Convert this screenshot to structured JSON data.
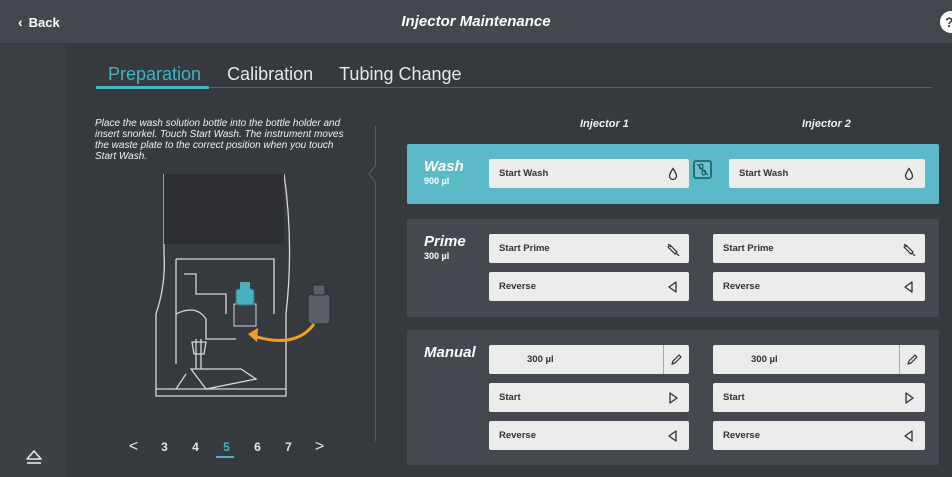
{
  "header": {
    "back_label": "Back",
    "title": "Injector Maintenance",
    "help_label": "?"
  },
  "tabs": [
    {
      "label": "Preparation",
      "active": true
    },
    {
      "label": "Calibration",
      "active": false
    },
    {
      "label": "Tubing Change",
      "active": false
    }
  ],
  "instructions": "Place the wash solution bottle into the bottle holder and insert snorkel. Touch Start Wash. The instrument moves the waste plate to the correct position when you touch Start Wash.",
  "pager": {
    "prev": "<",
    "next": ">",
    "pages": [
      "3",
      "4",
      "5",
      "6",
      "7"
    ],
    "active_page": "5"
  },
  "injectors": {
    "col1": "Injector 1",
    "col2": "Injector 2"
  },
  "wash": {
    "title": "Wash",
    "volume": "900 µl",
    "inj1_button": "Start Wash",
    "inj2_button": "Start Wash",
    "icon": "droplet-icon",
    "link_icon": "unlink-icon"
  },
  "prime": {
    "title": "Prime",
    "volume": "300 µl",
    "inj1_start": "Start Prime",
    "inj1_reverse": "Reverse",
    "inj2_start": "Start Prime",
    "inj2_reverse": "Reverse"
  },
  "manual": {
    "title": "Manual",
    "inj1_volume": "300 µl",
    "inj1_start": "Start",
    "inj1_reverse": "Reverse",
    "inj2_volume": "300 µl",
    "inj2_start": "Start",
    "inj2_reverse": "Reverse"
  },
  "colors": {
    "accent": "#3fb5c6",
    "wash_bg": "#5cb9c8",
    "panel": "#36393e",
    "section": "#45494f",
    "arrow": "#f0a020"
  }
}
